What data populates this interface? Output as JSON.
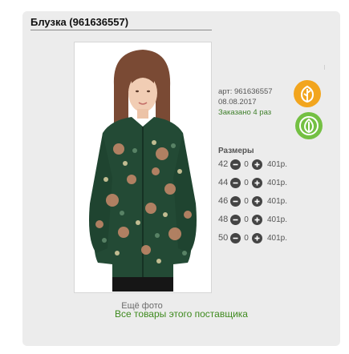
{
  "product": {
    "title": "Блузка (961636557)",
    "article": "арт: 961636557",
    "date": "08.08.2017",
    "ordered": "Заказано 4 раз",
    "more_photo": "Ещё фото"
  },
  "badges": [
    {
      "name": "supplier-badge",
      "icon": "leaf-icon",
      "color": "#f2a51e"
    },
    {
      "name": "eco-badge",
      "icon": "leaf-icon",
      "color": "#74c043"
    }
  ],
  "sizes": {
    "title": "Размеры",
    "rows": [
      {
        "size": "42",
        "qty": "0",
        "price": "401р."
      },
      {
        "size": "44",
        "qty": "0",
        "price": "401р."
      },
      {
        "size": "46",
        "qty": "0",
        "price": "401р."
      },
      {
        "size": "48",
        "qty": "0",
        "price": "401р."
      },
      {
        "size": "50",
        "qty": "0",
        "price": "401р."
      }
    ]
  },
  "footer": {
    "all_goods_link": "Все товары этого поставщика"
  },
  "colors": {
    "link_green": "#3e8a1e",
    "badge_orange": "#f2a51e",
    "badge_green": "#74c043",
    "blouse_green": "#234a35"
  }
}
